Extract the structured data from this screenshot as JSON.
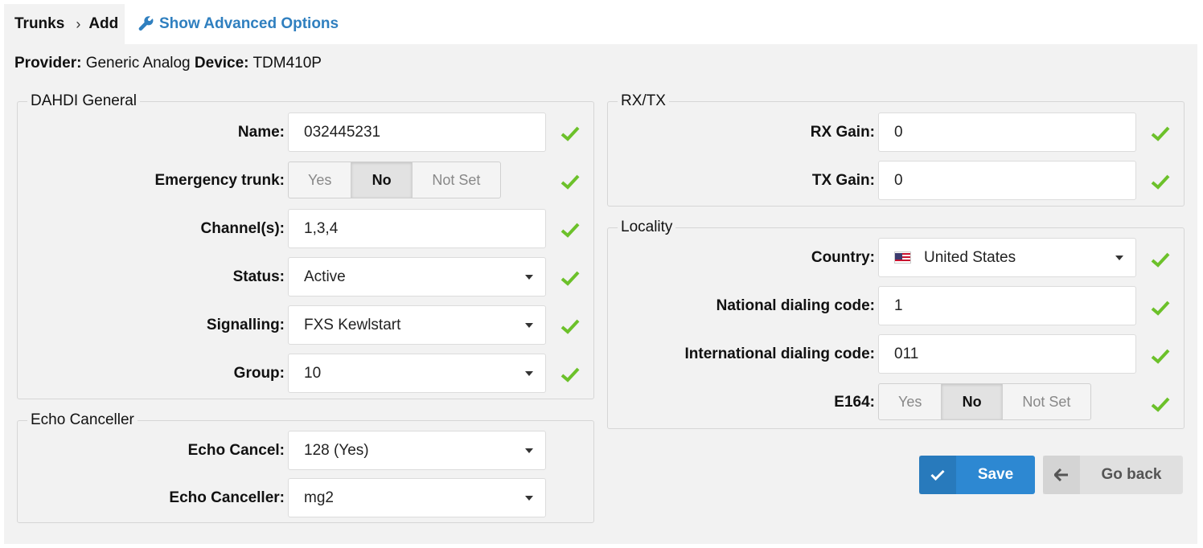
{
  "breadcrumb": {
    "trunks": "Trunks",
    "separator": "›",
    "add": "Add"
  },
  "advanced_label": "Show Advanced Options",
  "info": {
    "provider_label": "Provider:",
    "provider_value": "Generic Analog",
    "device_label": "Device:",
    "device_value": "TDM410P"
  },
  "dahdi": {
    "legend": "DAHDI General",
    "name_label": "Name:",
    "name_value": "032445231",
    "emergency_label": "Emergency trunk:",
    "emergency_options": [
      "Yes",
      "No",
      "Not Set"
    ],
    "emergency_selected": "No",
    "channels_label": "Channel(s):",
    "channels_value": "1,3,4",
    "status_label": "Status:",
    "status_value": "Active",
    "signalling_label": "Signalling:",
    "signalling_value": "FXS Kewlstart",
    "group_label": "Group:",
    "group_value": "10"
  },
  "echo": {
    "legend": "Echo Canceller",
    "cancel_label": "Echo Cancel:",
    "cancel_value": "128 (Yes)",
    "canceller_label": "Echo Canceller:",
    "canceller_value": "mg2"
  },
  "rxtx": {
    "legend": "RX/TX",
    "rx_label": "RX Gain:",
    "rx_value": "0",
    "tx_label": "TX Gain:",
    "tx_value": "0"
  },
  "locality": {
    "legend": "Locality",
    "country_label": "Country:",
    "country_value": "United States",
    "country_flag": "us-flag-icon",
    "national_label": "National dialing code:",
    "national_value": "1",
    "international_label": "International dialing code:",
    "international_value": "011",
    "e164_label": "E164:",
    "e164_options": [
      "Yes",
      "No",
      "Not Set"
    ],
    "e164_selected": "No"
  },
  "buttons": {
    "save": "Save",
    "back": "Go back"
  },
  "colors": {
    "accent": "#2d88d2",
    "check": "#6cc12a",
    "link": "#2f7fbf"
  }
}
